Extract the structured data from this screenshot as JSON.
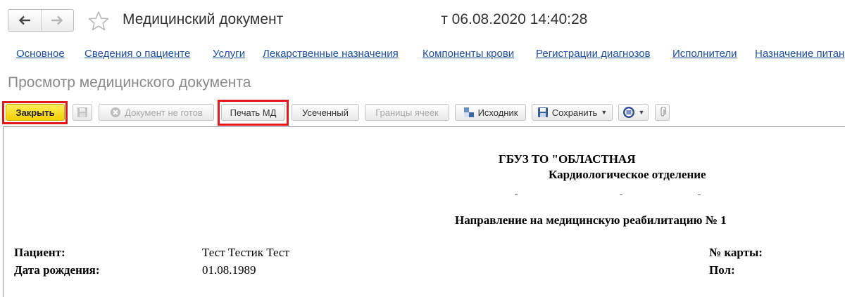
{
  "header": {
    "title": "Медицинский документ",
    "date_fragment": "от 06.08.2020 14:40:28",
    "back_icon": "arrow-left-icon",
    "forward_icon": "arrow-right-icon",
    "favorite_icon": "star-icon"
  },
  "links": [
    "Основное",
    "Сведения о пациенте",
    "Услуги",
    "Лекарственные назначения",
    "Компоненты крови",
    "Регистрации диагнозов",
    "Исполнители",
    "Назначение питан"
  ],
  "form_title": "Просмотр медицинского документа",
  "toolbar": {
    "close": "Закрыть",
    "doc_not_ready": "Документ не готов",
    "print_md": "Печать МД",
    "truncated": "Усеченный",
    "cell_borders": "Границы ячеек",
    "source": "Исходник",
    "save": "Сохранить"
  },
  "document": {
    "org_line": "ГБУЗ ТО \"ОБЛАСТНАЯ",
    "department": "Кардиологическое отделение",
    "referral_title": "Направление на медицинскую реабилитацию № 1",
    "patient_label": "Пациент:",
    "patient_value": "Тест Тестик Тест",
    "birth_label": "Дата рождения:",
    "birth_value": "01.08.1989",
    "card_label": "№ карты:",
    "sex_label": "Пол:"
  },
  "colors": {
    "link": "#1f4e9b",
    "highlight": "#e11919",
    "primary_button": "#f3cf00"
  }
}
